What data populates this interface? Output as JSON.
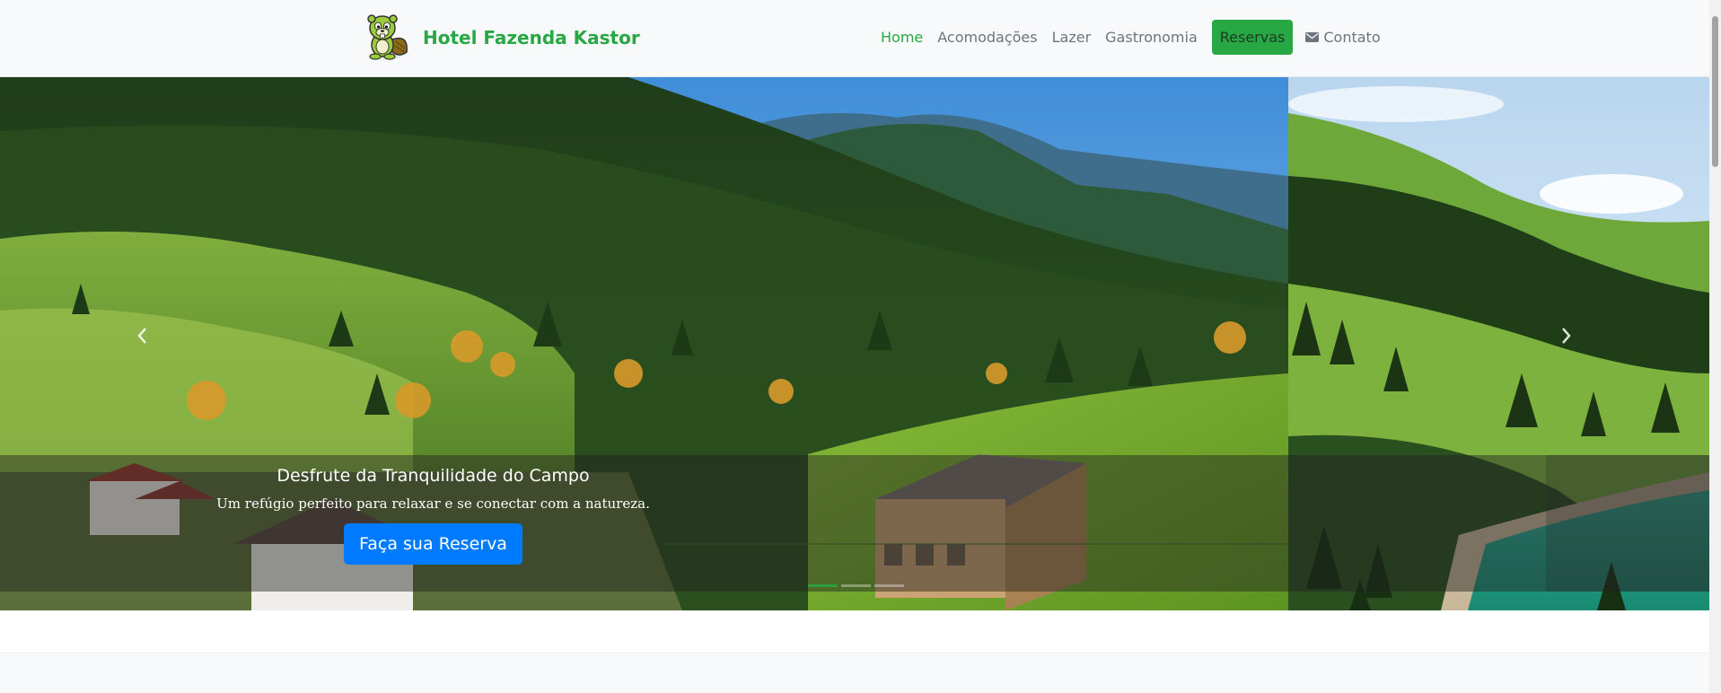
{
  "brand": {
    "name": "Hotel Fazenda Kastor",
    "logo": "beaver-mascot-logo"
  },
  "nav": {
    "items": [
      {
        "label": "Home",
        "active": true
      },
      {
        "label": "Acomodações",
        "active": false
      },
      {
        "label": "Lazer",
        "active": false
      },
      {
        "label": "Gastronomia",
        "active": false
      }
    ],
    "reserve_label": "Reservas",
    "contact_label": "Contato",
    "contact_icon": "envelope-icon"
  },
  "hero": {
    "title": "Desfrute da Tranquilidade do Campo",
    "subtitle": "Um refúgio perfeito para relaxar e se conectar com a natureza.",
    "cta_label": "Faça sua Reserva",
    "prev_icon": "chevron-left-icon",
    "next_icon": "chevron-right-icon",
    "slide_count": 3,
    "active_slide": 1
  },
  "colors": {
    "brand_green": "#28a745",
    "cta_blue": "#007bff",
    "nav_gray": "#6c757d",
    "navbar_bg": "#f8f9fa"
  }
}
